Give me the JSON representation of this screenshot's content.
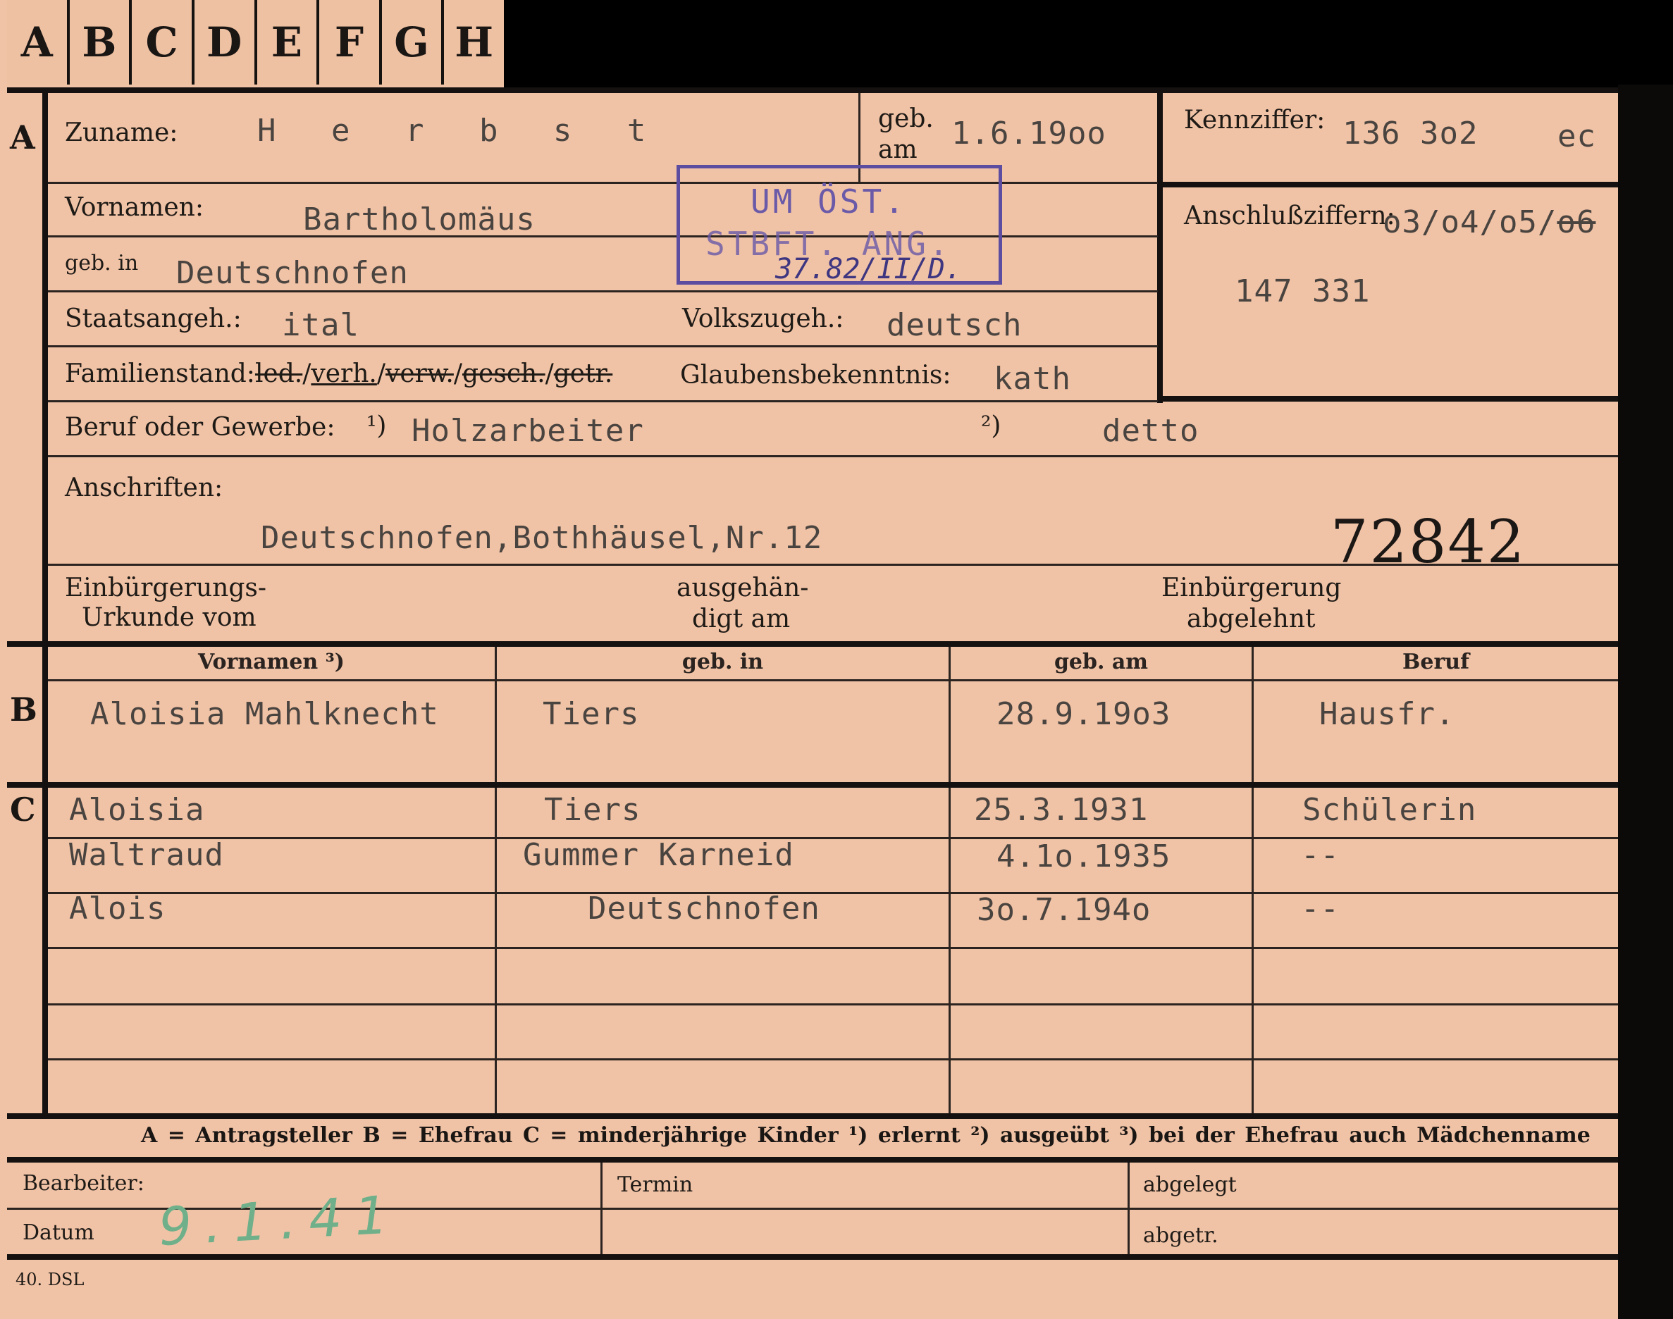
{
  "tabs": [
    "A",
    "B",
    "C",
    "D",
    "E",
    "F",
    "G",
    "H"
  ],
  "sections": {
    "a": "A",
    "b": "B",
    "c": "C"
  },
  "labels": {
    "zuname": "Zuname:",
    "geb_am_1": "geb.",
    "geb_am_2": "am",
    "kennziffer": "Kennziffer:",
    "vornamen": "Vornamen:",
    "anschluss": "Anschlußziffern:",
    "geb_in": "geb. in",
    "staatsangeh": "Staatsangeh.:",
    "volkszugeh": "Volkszugeh.:",
    "familienstand_prefix": "Familienstand:",
    "familienstand_1": "led.",
    "familienstand_2": "verh.",
    "familienstand_3": "verw.",
    "familienstand_4": "gesch.",
    "familienstand_5": "getr.",
    "glaubens": "Glaubensbekenntnis:",
    "beruf": "Beruf oder Gewerbe:",
    "beruf_n1": "¹)",
    "beruf_n2": "²)",
    "anschriften": "Anschriften:",
    "einb_1a": "Einbürgerungs-",
    "einb_1b": "Urkunde vom",
    "ausg_a": "ausgehän-",
    "ausg_b": "digt am",
    "einb_2a": "Einbürgerung",
    "einb_2b": "abgelehnt"
  },
  "person": {
    "zuname": "H e r b s t",
    "geb_am": "1.6.19oo",
    "kennziffer": "136 3o2",
    "kennziffer_suffix": "ec",
    "vornamen": "Bartholomäus",
    "anschluss": "o3/o4/o5/",
    "anschluss_struck": "o6",
    "anschluss_2": "147 331",
    "geb_in": "Deutschnofen",
    "staatsangeh": "ital",
    "volkszugeh": "deutsch",
    "glaubens": "kath",
    "beruf_1": "Holzarbeiter",
    "beruf_2": "detto",
    "anschrift": "Deutschnofen,Bothhäusel,Nr.12",
    "number": "72842"
  },
  "stamp": {
    "line1": "UM ÖST.",
    "line2": "STBFT. ANG.",
    "line3": "37.82/II/D."
  },
  "table": {
    "headers": [
      "Vornamen ³)",
      "geb. in",
      "geb. am",
      "Beruf"
    ],
    "spouse": [
      "Aloisia Mahlknecht",
      "Tiers",
      "28.9.19o3",
      "Hausfr."
    ],
    "children": [
      [
        "Aloisia",
        "Tiers",
        "25.3.1931",
        "Schülerin"
      ],
      [
        "Waltraud",
        "Gummer Karneid",
        "4.1o.1935",
        "--"
      ],
      [
        "Alois",
        "Deutschnofen",
        "3o.7.194o",
        "--"
      ]
    ]
  },
  "legend": "A = Antragsteller   B = Ehefrau   C = minderjährige Kinder   ¹) erlernt   ²) ausgeübt   ³) bei der Ehefrau auch Mädchenname",
  "footer": {
    "bearbeiter": "Bearbeiter:",
    "datum": "Datum",
    "termin": "Termin",
    "abgelegt": "abgelegt",
    "abgetr": "abgetr.",
    "datum_value": "9.1.41",
    "print_code": "40. DSL"
  }
}
